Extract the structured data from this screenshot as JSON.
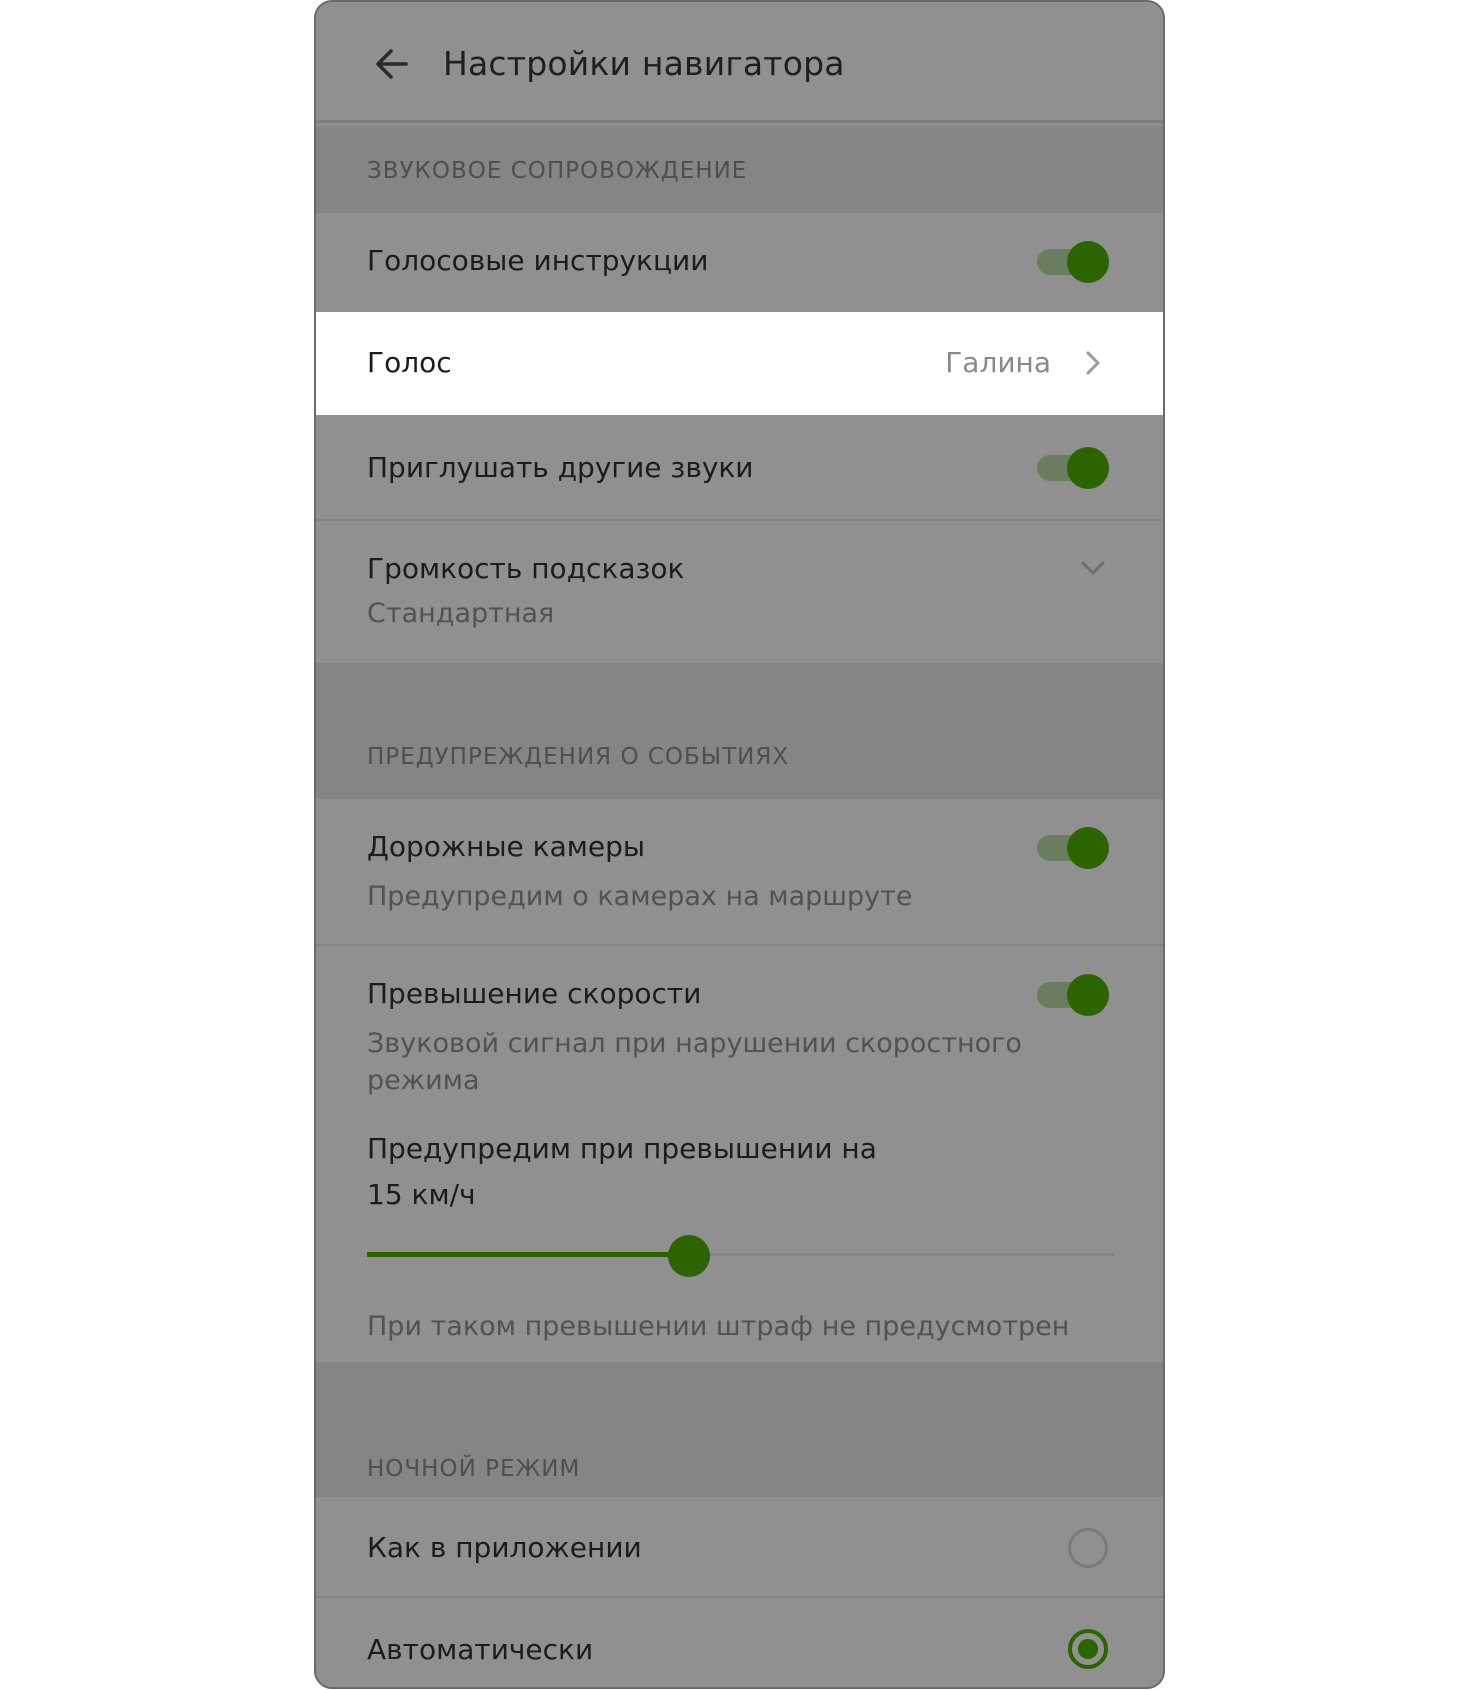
{
  "header": {
    "title": "Настройки навигатора",
    "back_icon": "arrow-left-icon"
  },
  "sections": {
    "sound": {
      "label": "ЗВУКОВОЕ СОПРОВОЖДЕНИЕ"
    },
    "events": {
      "label": "ПРЕДУПРЕЖДЕНИЯ О СОБЫТИЯХ"
    },
    "night": {
      "label": "НОЧНОЙ РЕЖИМ"
    }
  },
  "voice_instructions": {
    "label": "Голосовые инструкции",
    "enabled": true
  },
  "voice": {
    "label": "Голос",
    "value": "Галина"
  },
  "mute_other": {
    "label": "Приглушать другие звуки",
    "enabled": true
  },
  "volume": {
    "label": "Громкость подсказок",
    "value": "Стандартная"
  },
  "cameras": {
    "label": "Дорожные камеры",
    "description": "Предупредим о камерах на маршруте",
    "enabled": true
  },
  "speeding": {
    "label": "Превышение скорости",
    "description_line1": "Звуковой сигнал при нарушении скоростного",
    "description_line2": "режима",
    "enabled": true,
    "threshold_label": "Предупредим при превышении на",
    "threshold_value": "15 км/ч",
    "slider_fraction": 0.43,
    "note": "При таком превышении штраф не предусмотрен"
  },
  "night_mode": {
    "options": [
      {
        "label": "Как в приложении",
        "selected": false
      },
      {
        "label": "Автоматически",
        "selected": true
      }
    ]
  },
  "colors": {
    "accent": "#2c6400",
    "switch_track": "#6b7d5f",
    "overlay_background": "#909090",
    "section_background": "#858585",
    "highlight_row": "#ffffff"
  }
}
